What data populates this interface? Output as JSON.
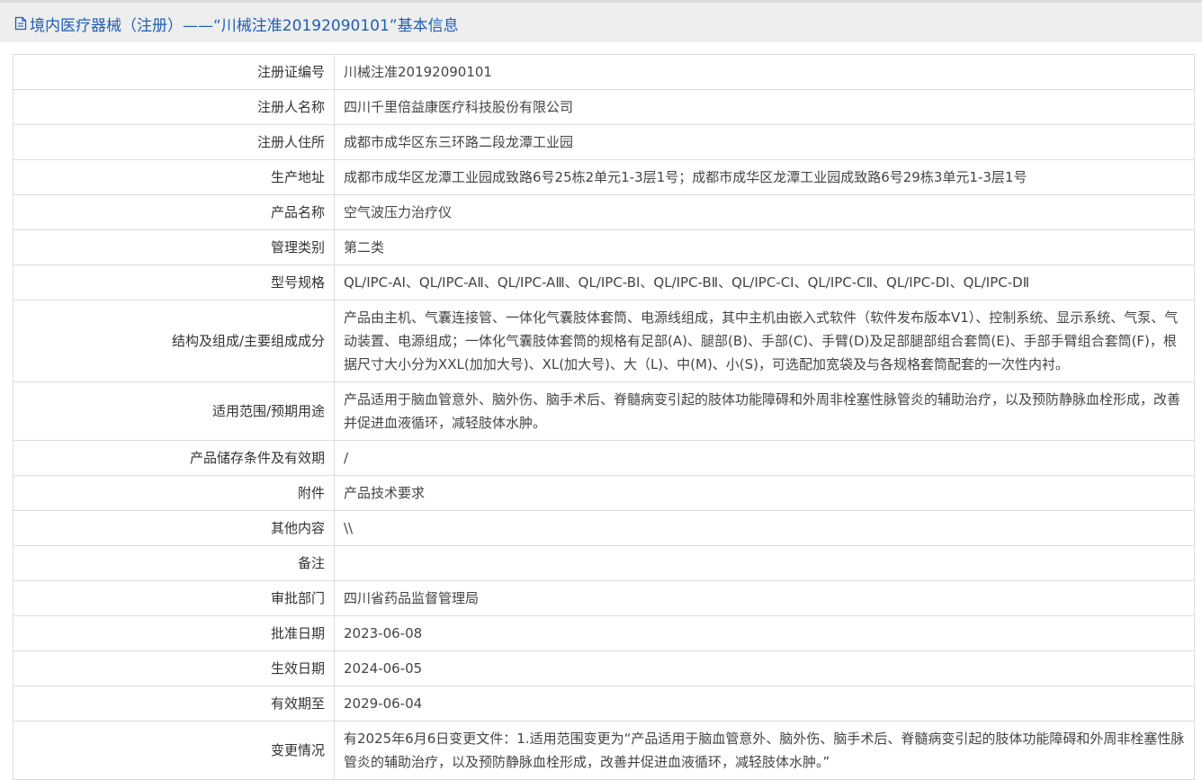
{
  "header": {
    "title": "境内医疗器械（注册）——“川械注准20192090101”基本信息",
    "icon": "document-icon",
    "color": "#1f5fb5"
  },
  "fields": [
    {
      "label": "注册证编号",
      "value": "川械注准20192090101"
    },
    {
      "label": "注册人名称",
      "value": "四川千里倍益康医疗科技股份有限公司"
    },
    {
      "label": "注册人住所",
      "value": "成都市成华区东三环路二段龙潭工业园"
    },
    {
      "label": "生产地址",
      "value": "成都市成华区龙潭工业园成致路6号25栋2单元1-3层1号；成都市成华区龙潭工业园成致路6号29栋3单元1-3层1号"
    },
    {
      "label": "产品名称",
      "value": "空气波压力治疗仪"
    },
    {
      "label": "管理类别",
      "value": "第二类"
    },
    {
      "label": "型号规格",
      "value": "QL/IPC-AⅠ、QL/IPC-AⅡ、QL/IPC-AⅢ、QL/IPC-BⅠ、QL/IPC-BⅡ、QL/IPC-CⅠ、QL/IPC-CⅡ、QL/IPC-DⅠ、QL/IPC-DⅡ"
    },
    {
      "label": "结构及组成/主要组成成分",
      "value": "产品由主机、气囊连接管、一体化气囊肢体套筒、电源线组成，其中主机由嵌入式软件（软件发布版本V1）、控制系统、显示系统、气泵、气动装置、电源组成；一体化气囊肢体套筒的规格有足部(A)、腿部(B)、手部(C)、手臂(D)及足部腿部组合套筒(E)、手部手臂组合套筒(F)，根据尺寸大小分为XXL(加加大号)、XL(加大号)、大（L)、中(M)、小(S)，可选配加宽袋及与各规格套筒配套的一次性内衬。"
    },
    {
      "label": "适用范围/预期用途",
      "value": "产品适用于脑血管意外、脑外伤、脑手术后、脊髓病变引起的肢体功能障碍和外周非栓塞性脉管炎的辅助治疗，以及预防静脉血栓形成，改善并促进血液循环，减轻肢体水肿。"
    },
    {
      "label": "产品储存条件及有效期",
      "value": "/"
    },
    {
      "label": "附件",
      "value": "产品技术要求"
    },
    {
      "label": "其他内容",
      "value": "\\\\"
    },
    {
      "label": "备注",
      "value": ""
    },
    {
      "label": "审批部门",
      "value": "四川省药品监督管理局"
    },
    {
      "label": "批准日期",
      "value": "2023-06-08"
    },
    {
      "label": "生效日期",
      "value": "2024-06-05"
    },
    {
      "label": "有效期至",
      "value": "2029-06-04"
    },
    {
      "label": "变更情况",
      "value": "有2025年6月6日变更文件：1.适用范围变更为“产品适用于脑血管意外、脑外伤、脑手术后、脊髓病变引起的肢体功能障碍和外周非栓塞性脉管炎的辅助治疗，以及预防静脉血栓形成，改善并促进血液循环，减轻肢体水肿。”"
    }
  ]
}
